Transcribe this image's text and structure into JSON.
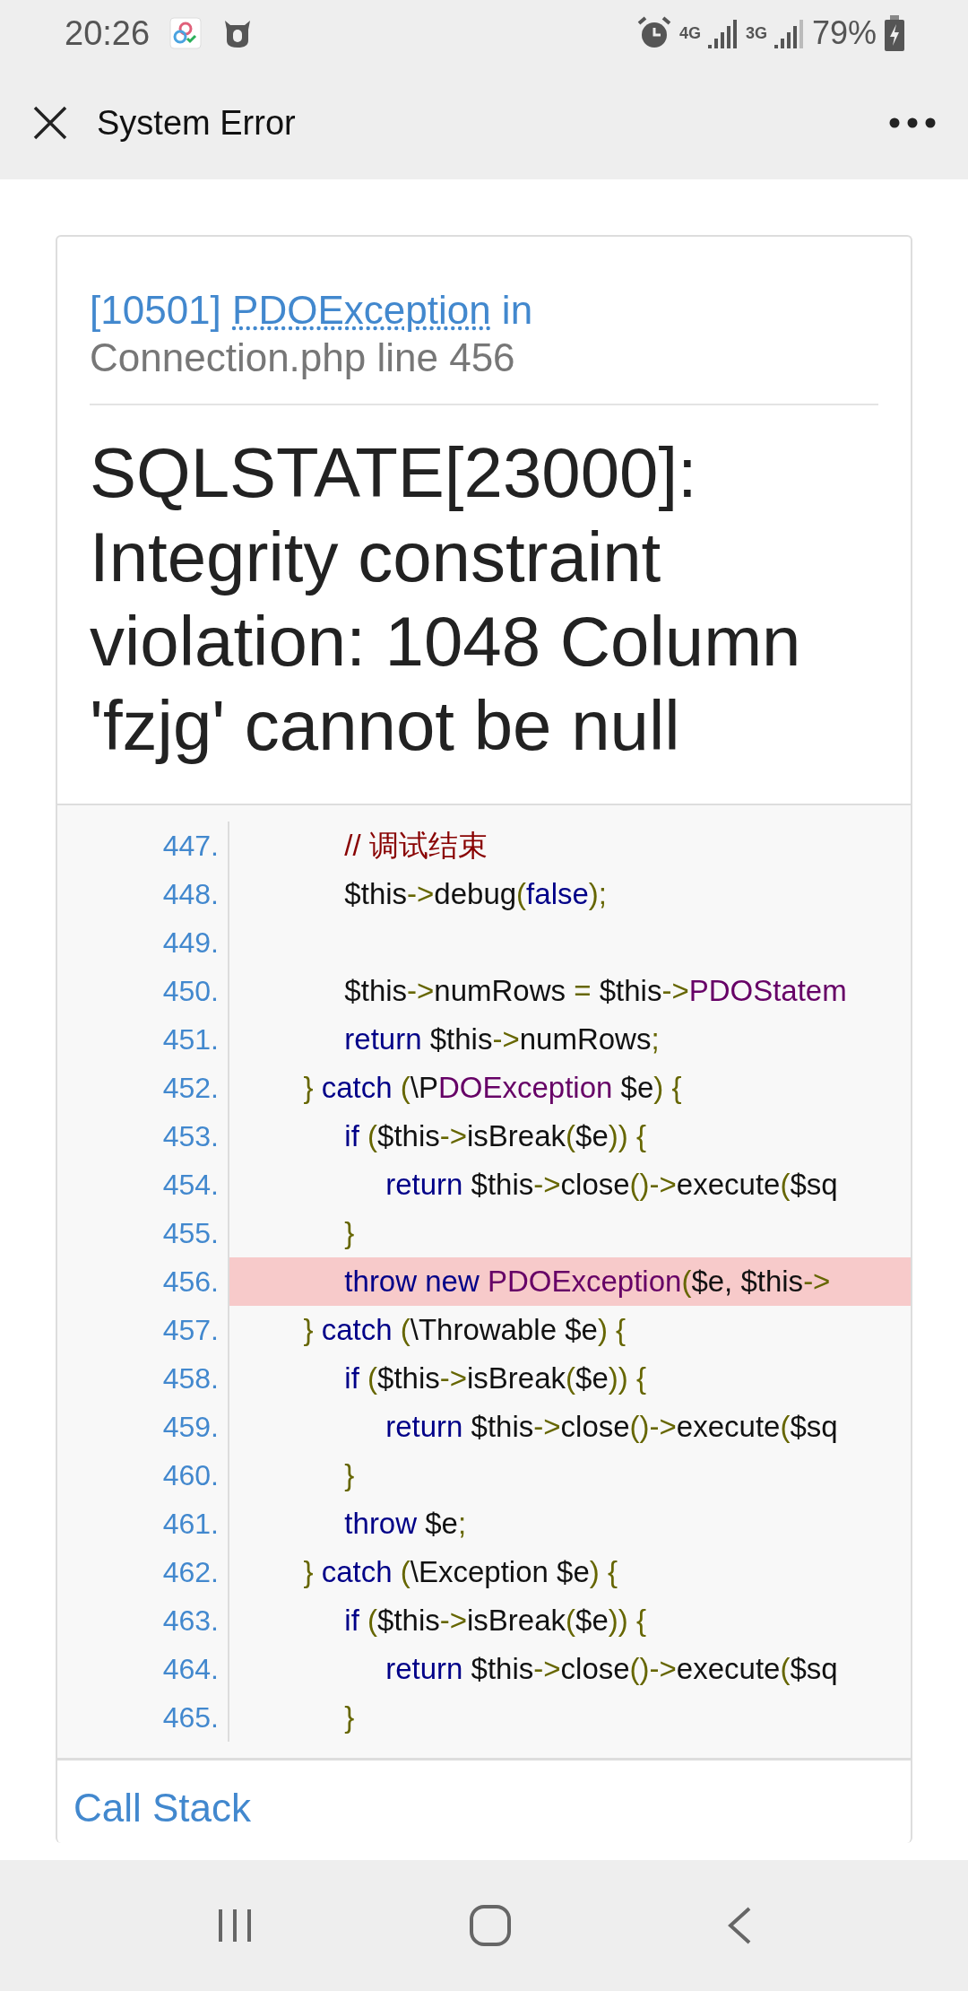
{
  "status_bar": {
    "time": "20:26",
    "network_1": "4G",
    "network_2": "3G",
    "battery": "79%"
  },
  "app_bar": {
    "title": "System Error"
  },
  "error": {
    "code": "[10501]",
    "exception": "PDOException",
    "suffix": "in",
    "location": "Connection.php line 456",
    "message": "SQLSTATE[23000]: Integrity constraint violation: 1048 Column 'fzjg' cannot be null"
  },
  "code_lines": [
    {
      "number": "447.",
      "highlighted": false,
      "tokens": [
        {
          "kind": "comment",
          "text": "              // 调试结束"
        }
      ]
    },
    {
      "number": "448.",
      "highlighted": false,
      "tokens": [
        {
          "kind": "plain",
          "text": "              $this"
        },
        {
          "kind": "punct",
          "text": "->"
        },
        {
          "kind": "plain",
          "text": "debug"
        },
        {
          "kind": "punct",
          "text": "("
        },
        {
          "kind": "keyword",
          "text": "false"
        },
        {
          "kind": "punct",
          "text": ");"
        }
      ]
    },
    {
      "number": "449.",
      "highlighted": false
    },
    {
      "number": "450.",
      "highlighted": false,
      "tokens": [
        {
          "kind": "plain",
          "text": "              $this"
        },
        {
          "kind": "punct",
          "text": "->"
        },
        {
          "kind": "plain",
          "text": "numRows "
        },
        {
          "kind": "punct",
          "text": "="
        },
        {
          "kind": "plain",
          "text": " $this"
        },
        {
          "kind": "punct",
          "text": "->"
        },
        {
          "kind": "class",
          "text": "PDOStatem"
        }
      ]
    },
    {
      "number": "451.",
      "highlighted": false,
      "tokens": [
        {
          "kind": "keyword",
          "text": "              return"
        },
        {
          "kind": "plain",
          "text": " $this"
        },
        {
          "kind": "punct",
          "text": "->"
        },
        {
          "kind": "plain",
          "text": "numRows"
        },
        {
          "kind": "punct",
          "text": ";"
        }
      ]
    },
    {
      "number": "452.",
      "highlighted": false,
      "tokens": [
        {
          "kind": "punct",
          "text": "         }"
        },
        {
          "kind": "keyword",
          "text": " catch "
        },
        {
          "kind": "punct",
          "text": "("
        },
        {
          "kind": "plain",
          "text": "\\P"
        },
        {
          "kind": "class",
          "text": "DOException"
        },
        {
          "kind": "plain",
          "text": " $e"
        },
        {
          "kind": "punct",
          "text": ") {"
        }
      ]
    },
    {
      "number": "453.",
      "highlighted": false,
      "tokens": [
        {
          "kind": "keyword",
          "text": "              if "
        },
        {
          "kind": "punct",
          "text": "("
        },
        {
          "kind": "plain",
          "text": "$this"
        },
        {
          "kind": "punct",
          "text": "->"
        },
        {
          "kind": "plain",
          "text": "isBreak"
        },
        {
          "kind": "punct",
          "text": "("
        },
        {
          "kind": "plain",
          "text": "$e"
        },
        {
          "kind": "punct",
          "text": ")) {"
        }
      ]
    },
    {
      "number": "454.",
      "highlighted": false,
      "tokens": [
        {
          "kind": "keyword",
          "text": "                   return"
        },
        {
          "kind": "plain",
          "text": " $this"
        },
        {
          "kind": "punct",
          "text": "->"
        },
        {
          "kind": "plain",
          "text": "close"
        },
        {
          "kind": "punct",
          "text": "()->"
        },
        {
          "kind": "plain",
          "text": "execute"
        },
        {
          "kind": "punct",
          "text": "("
        },
        {
          "kind": "plain",
          "text": "$sq"
        }
      ]
    },
    {
      "number": "455.",
      "highlighted": false,
      "tokens": [
        {
          "kind": "punct",
          "text": "              }"
        }
      ]
    },
    {
      "number": "456.",
      "highlighted": true,
      "tokens": [
        {
          "kind": "keyword",
          "text": "              throw new "
        },
        {
          "kind": "class",
          "text": "PDOException"
        },
        {
          "kind": "punct",
          "text": "("
        },
        {
          "kind": "plain",
          "text": "$e, $this"
        },
        {
          "kind": "punct",
          "text": "->"
        }
      ]
    },
    {
      "number": "457.",
      "highlighted": false,
      "tokens": [
        {
          "kind": "punct",
          "text": "         }"
        },
        {
          "kind": "keyword",
          "text": " catch "
        },
        {
          "kind": "punct",
          "text": "("
        },
        {
          "kind": "plain",
          "text": "\\Throwable $e"
        },
        {
          "kind": "punct",
          "text": ") {"
        }
      ]
    },
    {
      "number": "458.",
      "highlighted": false,
      "tokens": [
        {
          "kind": "keyword",
          "text": "              if "
        },
        {
          "kind": "punct",
          "text": "("
        },
        {
          "kind": "plain",
          "text": "$this"
        },
        {
          "kind": "punct",
          "text": "->"
        },
        {
          "kind": "plain",
          "text": "isBreak"
        },
        {
          "kind": "punct",
          "text": "("
        },
        {
          "kind": "plain",
          "text": "$e"
        },
        {
          "kind": "punct",
          "text": ")) {"
        }
      ]
    },
    {
      "number": "459.",
      "highlighted": false,
      "tokens": [
        {
          "kind": "keyword",
          "text": "                   return"
        },
        {
          "kind": "plain",
          "text": " $this"
        },
        {
          "kind": "punct",
          "text": "->"
        },
        {
          "kind": "plain",
          "text": "close"
        },
        {
          "kind": "punct",
          "text": "()->"
        },
        {
          "kind": "plain",
          "text": "execute"
        },
        {
          "kind": "punct",
          "text": "("
        },
        {
          "kind": "plain",
          "text": "$sq"
        }
      ]
    },
    {
      "number": "460.",
      "highlighted": false,
      "tokens": [
        {
          "kind": "punct",
          "text": "              }"
        }
      ]
    },
    {
      "number": "461.",
      "highlighted": false,
      "tokens": [
        {
          "kind": "keyword",
          "text": "              throw"
        },
        {
          "kind": "plain",
          "text": " $e"
        },
        {
          "kind": "punct",
          "text": ";"
        }
      ]
    },
    {
      "number": "462.",
      "highlighted": false,
      "tokens": [
        {
          "kind": "punct",
          "text": "         }"
        },
        {
          "kind": "keyword",
          "text": " catch "
        },
        {
          "kind": "punct",
          "text": "("
        },
        {
          "kind": "plain",
          "text": "\\Exception $e"
        },
        {
          "kind": "punct",
          "text": ") {"
        }
      ]
    },
    {
      "number": "463.",
      "highlighted": false,
      "tokens": [
        {
          "kind": "keyword",
          "text": "              if "
        },
        {
          "kind": "punct",
          "text": "("
        },
        {
          "kind": "plain",
          "text": "$this"
        },
        {
          "kind": "punct",
          "text": "->"
        },
        {
          "kind": "plain",
          "text": "isBreak"
        },
        {
          "kind": "punct",
          "text": "("
        },
        {
          "kind": "plain",
          "text": "$e"
        },
        {
          "kind": "punct",
          "text": ")) {"
        }
      ]
    },
    {
      "number": "464.",
      "highlighted": false,
      "tokens": [
        {
          "kind": "keyword",
          "text": "                   return"
        },
        {
          "kind": "plain",
          "text": " $this"
        },
        {
          "kind": "punct",
          "text": "->"
        },
        {
          "kind": "plain",
          "text": "close"
        },
        {
          "kind": "punct",
          "text": "()->"
        },
        {
          "kind": "plain",
          "text": "execute"
        },
        {
          "kind": "punct",
          "text": "("
        },
        {
          "kind": "plain",
          "text": "$sq"
        }
      ]
    },
    {
      "number": "465.",
      "highlighted": false,
      "tokens": [
        {
          "kind": "punct",
          "text": "              }"
        }
      ]
    }
  ],
  "call_stack": {
    "title": "Call Stack"
  }
}
